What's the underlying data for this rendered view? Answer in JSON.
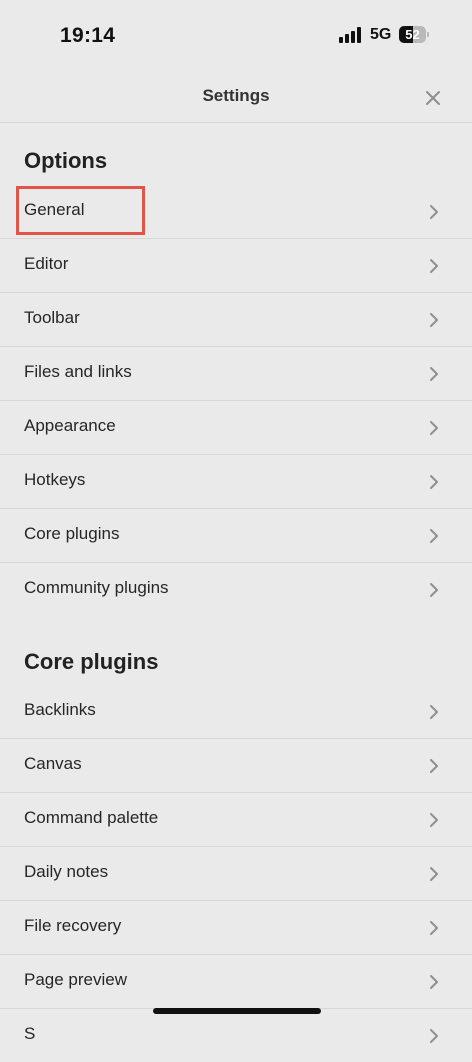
{
  "status_bar": {
    "time": "19:14",
    "network": "5G",
    "battery_percent": "52",
    "battery_level": 0.52
  },
  "header": {
    "title": "Settings",
    "close_icon": "close-icon"
  },
  "sections": [
    {
      "heading": "Options",
      "items": [
        {
          "label": "General"
        },
        {
          "label": "Editor"
        },
        {
          "label": "Toolbar"
        },
        {
          "label": "Files and links"
        },
        {
          "label": "Appearance"
        },
        {
          "label": "Hotkeys"
        },
        {
          "label": "Core plugins"
        },
        {
          "label": "Community plugins"
        }
      ]
    },
    {
      "heading": "Core plugins",
      "items": [
        {
          "label": "Backlinks"
        },
        {
          "label": "Canvas"
        },
        {
          "label": "Command palette"
        },
        {
          "label": "Daily notes"
        },
        {
          "label": "File recovery"
        },
        {
          "label": "Page preview"
        },
        {
          "label": "S"
        }
      ]
    }
  ],
  "highlight": {
    "target": "General",
    "color": "#e05449"
  },
  "colors": {
    "background": "#ebeaeb",
    "separator": "#d9d8d9",
    "text": "#262626",
    "chevron": "#8e8e93"
  }
}
